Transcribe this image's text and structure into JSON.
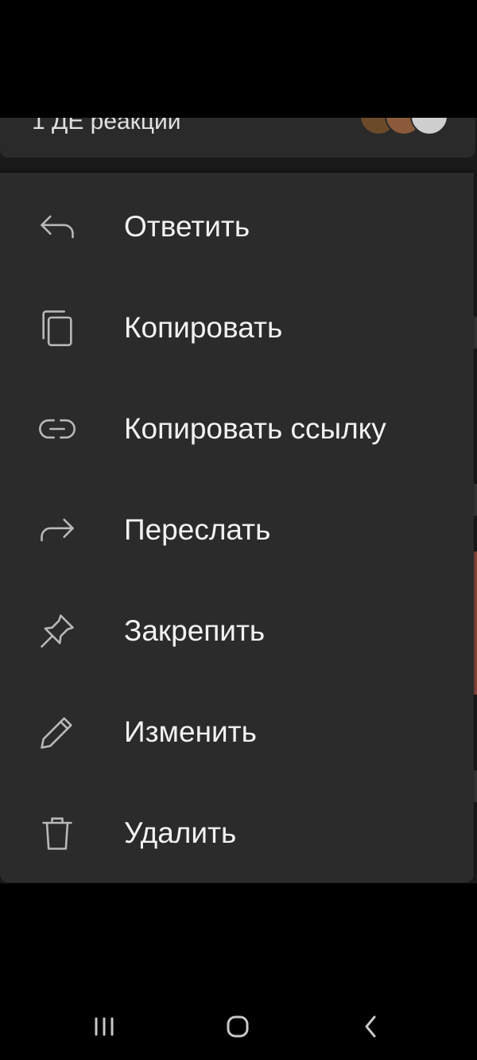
{
  "reactions": {
    "text": "1 ДЕ реакции",
    "avatar_count": 3
  },
  "context_menu": {
    "items": [
      {
        "label": "Ответить",
        "icon": "reply-icon"
      },
      {
        "label": "Копировать",
        "icon": "copy-icon"
      },
      {
        "label": "Копировать ссылку",
        "icon": "link-icon"
      },
      {
        "label": "Переслать",
        "icon": "forward-icon"
      },
      {
        "label": "Закрепить",
        "icon": "pin-icon"
      },
      {
        "label": "Изменить",
        "icon": "pencil-icon"
      },
      {
        "label": "Удалить",
        "icon": "trash-icon"
      }
    ]
  },
  "nav_bar": {
    "buttons": [
      {
        "icon": "recent-apps-icon"
      },
      {
        "icon": "home-icon"
      },
      {
        "icon": "back-icon"
      }
    ]
  },
  "colors": {
    "menu_background": "#2b2b2b",
    "menu_text": "#f2f2f2",
    "icon_stroke": "#b8b8b8",
    "screen_background": "#000000"
  }
}
